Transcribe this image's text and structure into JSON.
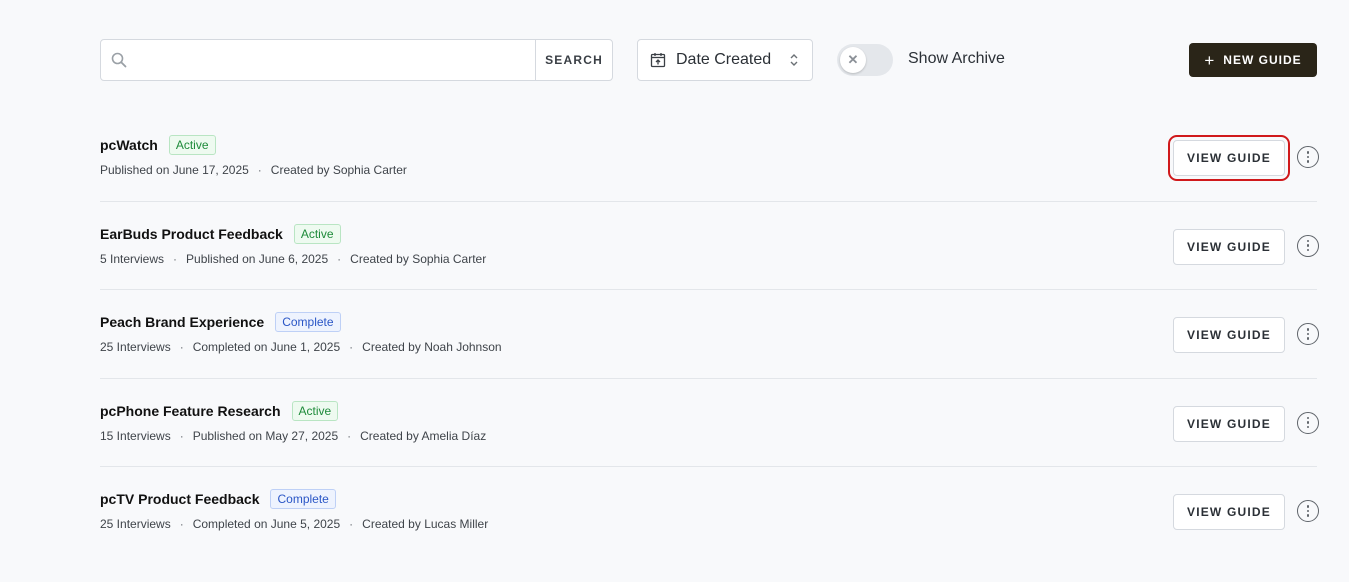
{
  "toolbar": {
    "search": {
      "placeholder": "",
      "value": "",
      "button_label": "SEARCH",
      "icon": "search-icon"
    },
    "sort": {
      "label": "Date Created",
      "icon": "calendar-icon",
      "chevron": "sort-chevron-icon"
    },
    "archive_toggle": {
      "label": "Show Archive",
      "on": false,
      "knob_glyph": "✕"
    },
    "new_guide": {
      "label": "NEW GUIDE",
      "icon_glyph": "+"
    }
  },
  "guides": [
    {
      "title": "pcWatch",
      "status": "Active",
      "meta": [
        "Published on June 17, 2025",
        "Created by Sophia Carter"
      ],
      "button_label": "VIEW GUIDE",
      "highlighted": true
    },
    {
      "title": "EarBuds Product Feedback",
      "status": "Active",
      "meta": [
        "5 Interviews",
        "Published on June 6, 2025",
        "Created by Sophia Carter"
      ],
      "button_label": "VIEW GUIDE",
      "highlighted": false
    },
    {
      "title": "Peach Brand Experience",
      "status": "Complete",
      "meta": [
        "25 Interviews",
        "Completed on June 1, 2025",
        "Created by Noah Johnson"
      ],
      "button_label": "VIEW GUIDE",
      "highlighted": false
    },
    {
      "title": "pcPhone Feature Research",
      "status": "Active",
      "meta": [
        "15 Interviews",
        "Published on May 27, 2025",
        "Created by Amelia Díaz"
      ],
      "button_label": "VIEW GUIDE",
      "highlighted": false
    },
    {
      "title": "pcTV Product Feedback",
      "status": "Complete",
      "meta": [
        "25 Interviews",
        "Completed on June 5, 2025",
        "Created by Lucas Miller"
      ],
      "button_label": "VIEW GUIDE",
      "highlighted": false
    }
  ],
  "separator": "·",
  "colors": {
    "active": "#1e8a3a",
    "complete": "#2a56c6",
    "primary_button": "#2a2518",
    "highlight": "#d0191b"
  }
}
